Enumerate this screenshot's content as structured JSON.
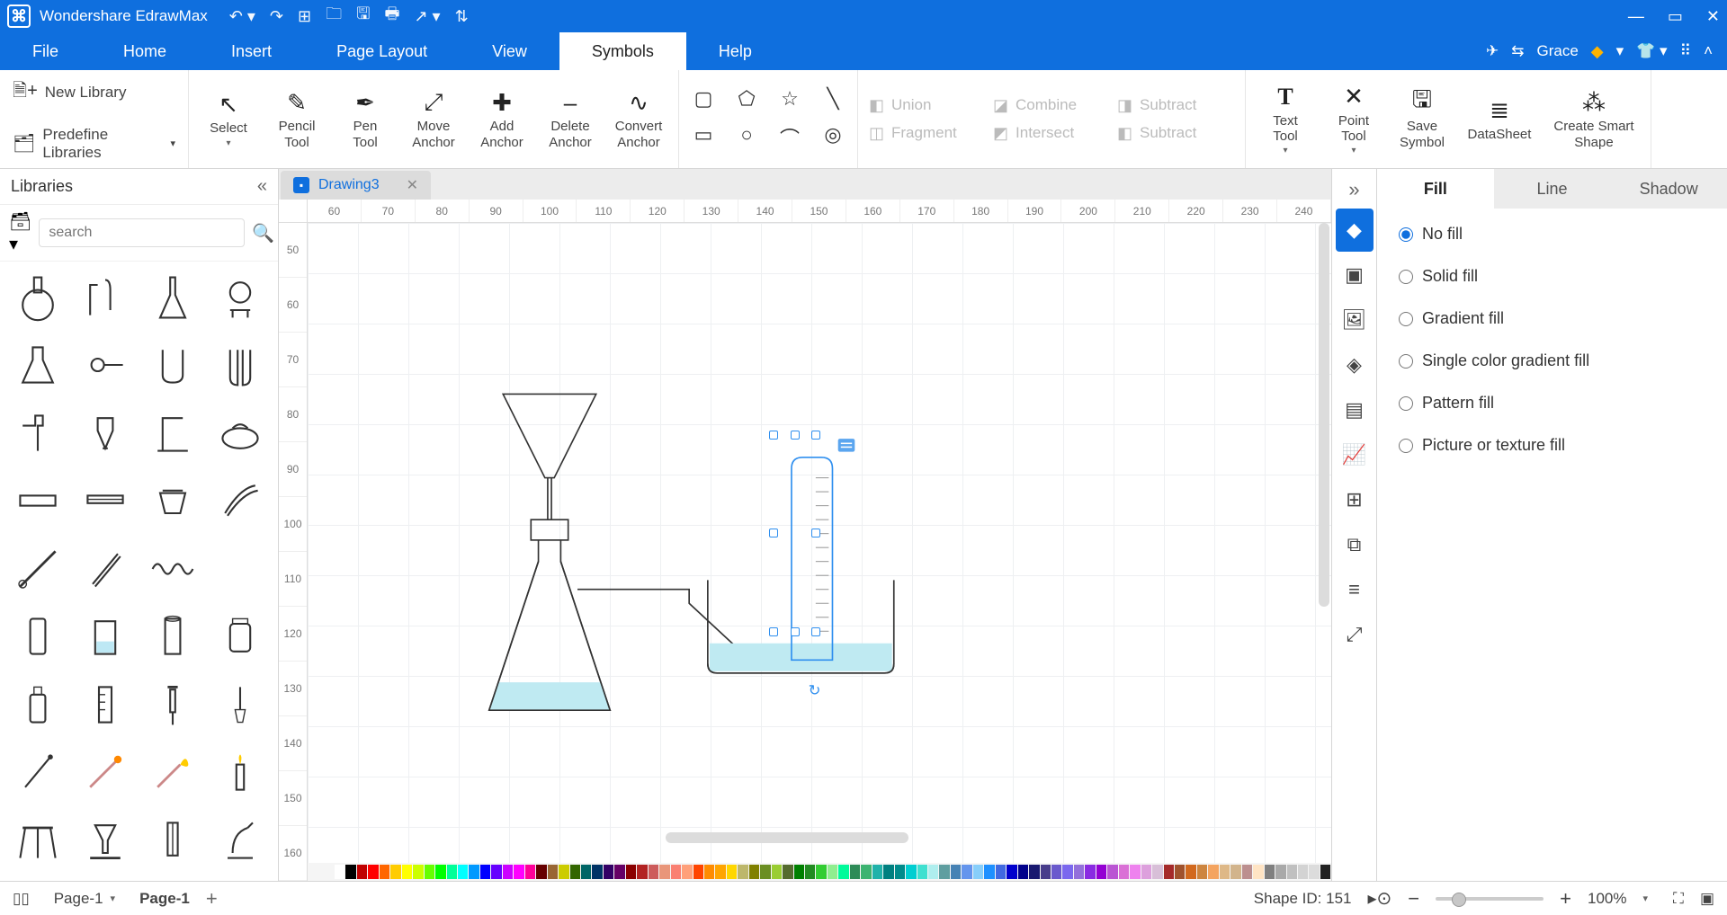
{
  "app": {
    "title": "Wondershare EdrawMax"
  },
  "menus": [
    "File",
    "Home",
    "Insert",
    "Page Layout",
    "View",
    "Symbols",
    "Help"
  ],
  "active_menu": "Symbols",
  "user": {
    "name": "Grace"
  },
  "ribbon": {
    "library_group": {
      "new": "New Library",
      "predef": "Predefine Libraries"
    },
    "tools": [
      {
        "label": "Select",
        "icon": "↖",
        "drop": true
      },
      {
        "label": "Pencil\nTool",
        "icon": "✎"
      },
      {
        "label": "Pen\nTool",
        "icon": "✒"
      },
      {
        "label": "Move\nAnchor",
        "icon": "⤢"
      },
      {
        "label": "Add\nAnchor",
        "icon": "✚"
      },
      {
        "label": "Delete\nAnchor",
        "icon": "‒"
      },
      {
        "label": "Convert\nAnchor",
        "icon": "∿"
      }
    ],
    "shapes_top": [
      "▢",
      "⬠",
      "☆",
      "╲"
    ],
    "shapes_bottom": [
      "▭",
      "○",
      "⌒",
      "◎"
    ],
    "boolean": [
      "Union",
      "Combine",
      "Subtract",
      "Fragment",
      "Intersect",
      "Subtract"
    ],
    "right_tools": [
      {
        "label": "Text\nTool",
        "icon": "T",
        "drop": true
      },
      {
        "label": "Point\nTool",
        "icon": "✕",
        "drop": true
      },
      {
        "label": "Save\nSymbol",
        "icon": "💾"
      },
      {
        "label": "DataSheet",
        "icon": "≣"
      },
      {
        "label": "Create Smart\nShape",
        "icon": "⁂"
      }
    ]
  },
  "libraries": {
    "title": "Libraries",
    "search_placeholder": "search"
  },
  "doctab": {
    "name": "Drawing3"
  },
  "hruler": [
    "60",
    "70",
    "80",
    "90",
    "100",
    "110",
    "120",
    "130",
    "140",
    "150",
    "160",
    "170",
    "180",
    "190",
    "200",
    "210",
    "220",
    "230",
    "240"
  ],
  "vruler": [
    "50",
    "60",
    "70",
    "80",
    "90",
    "100",
    "110",
    "120",
    "130",
    "140",
    "150",
    "160"
  ],
  "palette_colors": [
    "#ffffff",
    "#000000",
    "#c00000",
    "#ff0000",
    "#ff6600",
    "#ffcc00",
    "#ffff00",
    "#ccff00",
    "#66ff00",
    "#00ff00",
    "#00ff99",
    "#00ffff",
    "#0099ff",
    "#0000ff",
    "#6600ff",
    "#cc00ff",
    "#ff00ff",
    "#ff0099",
    "#660000",
    "#996633",
    "#cccc00",
    "#336600",
    "#006666",
    "#003366",
    "#330066",
    "#660066",
    "#8b0000",
    "#b22222",
    "#cd5c5c",
    "#e9967a",
    "#fa8072",
    "#ffa07a",
    "#ff4500",
    "#ff8c00",
    "#ffa500",
    "#ffd700",
    "#bdb76b",
    "#808000",
    "#6b8e23",
    "#9acd32",
    "#556b2f",
    "#008000",
    "#228b22",
    "#32cd32",
    "#90ee90",
    "#00fa9a",
    "#2e8b57",
    "#3cb371",
    "#20b2aa",
    "#008080",
    "#008b8b",
    "#00ced1",
    "#40e0d0",
    "#afeeee",
    "#5f9ea0",
    "#4682b4",
    "#6495ed",
    "#87cefa",
    "#1e90ff",
    "#4169e1",
    "#0000cd",
    "#00008b",
    "#191970",
    "#483d8b",
    "#6a5acd",
    "#7b68ee",
    "#9370db",
    "#8a2be2",
    "#9400d3",
    "#ba55d3",
    "#da70d6",
    "#ee82ee",
    "#dda0dd",
    "#d8bfd8",
    "#a52a2a",
    "#a0522d",
    "#d2691e",
    "#cd853f",
    "#f4a460",
    "#deb887",
    "#d2b48c",
    "#bc8f8f",
    "#ffe4c4",
    "#808080",
    "#a9a9a9",
    "#c0c0c0",
    "#d3d3d3",
    "#dcdcdc",
    "#222222"
  ],
  "right_icons": [
    "▣",
    "◫",
    "🖼",
    "◈",
    "▤",
    "📈",
    "⊞",
    "⧉",
    "≡",
    "⤢"
  ],
  "fill_panel": {
    "tabs": [
      "Fill",
      "Line",
      "Shadow"
    ],
    "active_tab": "Fill",
    "options": [
      "No fill",
      "Solid fill",
      "Gradient fill",
      "Single color gradient fill",
      "Pattern fill",
      "Picture or texture fill"
    ],
    "selected": "No fill"
  },
  "status": {
    "page_select": "Page-1",
    "page_label": "Page-1",
    "shape_id_label": "Shape ID: 151",
    "zoom": "100%"
  }
}
